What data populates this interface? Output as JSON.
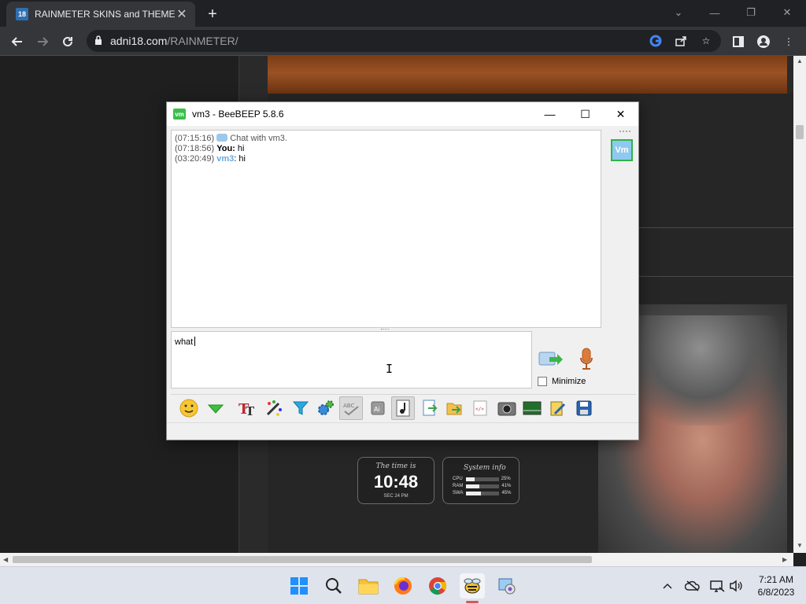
{
  "browser": {
    "tab": {
      "title": "RAINMETER SKINS and THEMES",
      "favicon_text": "18"
    },
    "url": {
      "domain": "adni18.com",
      "path": "/RAINMETER/"
    }
  },
  "page": {
    "widgets": {
      "time": {
        "label": "The time is",
        "time": "10:48",
        "date": "SEC  24  PM"
      },
      "system": {
        "label": "System info",
        "rows": [
          {
            "name": "CPU",
            "value": "25%",
            "fill": 0.25
          },
          {
            "name": "RAM",
            "value": "41%",
            "fill": 0.41
          },
          {
            "name": "SWA",
            "value": "45%",
            "fill": 0.45
          }
        ]
      }
    }
  },
  "beebeep": {
    "title": "vm3 - BeeBEEP 5.8.6",
    "icon_text": "vm",
    "avatar_text": "Vm",
    "messages": [
      {
        "time": "(07:15:16)",
        "text": "Chat with vm3."
      },
      {
        "time": "(07:18:56)",
        "sender": "You:",
        "text": " hi"
      },
      {
        "time": "(03:20:49)",
        "sender": "vm3",
        "text": ": hi"
      }
    ],
    "input_value": "what",
    "minimize_label": "Minimize"
  },
  "taskbar": {
    "time": "7:21 AM",
    "date": "6/8/2023"
  }
}
